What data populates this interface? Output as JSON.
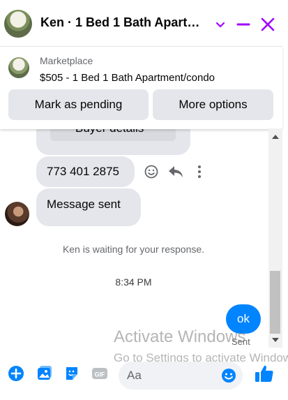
{
  "header": {
    "title": "Ken · 1 Bed 1 Bath Apartm…",
    "chevron_icon": "chevron-down-icon",
    "minimize_icon": "minus-icon",
    "close_icon": "close-icon",
    "accent_color": "#a100ff"
  },
  "marketplace": {
    "label": "Marketplace",
    "listing": "$505 - 1 Bed 1 Bath Apartment/condo",
    "mark_pending_label": "Mark as pending",
    "more_options_label": "More options"
  },
  "messages": {
    "partial_bubble_text": "Buyer details",
    "phone_text": "773 401 2875",
    "message_sent_text": "Message sent",
    "waiting_text": "Ken is waiting for your response.",
    "timestamp": "8:34 PM",
    "my_message": "ok",
    "my_message_status": "Sent",
    "my_bubble_color": "#0084ff"
  },
  "composer": {
    "placeholder": "Aa"
  },
  "overlay": {
    "activate_line1": "Activate Windows",
    "activate_line2": "Go to Settings to activate Windows."
  }
}
